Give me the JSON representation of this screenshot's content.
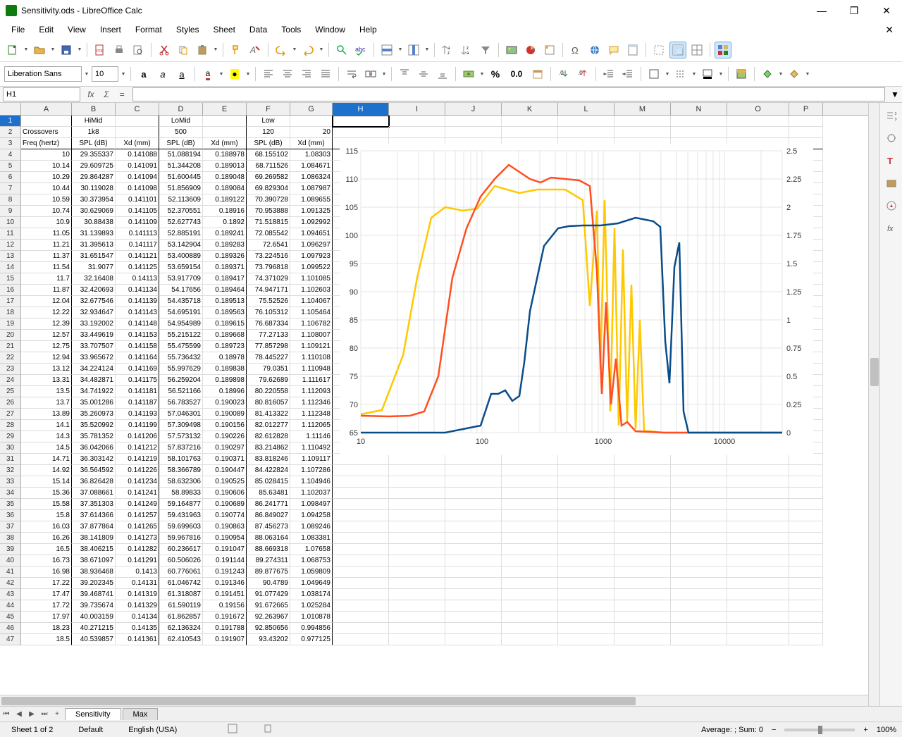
{
  "window": {
    "title": "Sensitivity.ods - LibreOffice Calc"
  },
  "menu": [
    "File",
    "Edit",
    "View",
    "Insert",
    "Format",
    "Styles",
    "Sheet",
    "Data",
    "Tools",
    "Window",
    "Help"
  ],
  "font": {
    "name": "Liberation Sans",
    "size": "10"
  },
  "namebox": "H1",
  "formula": "",
  "columns": [
    "A",
    "B",
    "C",
    "D",
    "E",
    "F",
    "G",
    "H",
    "I",
    "J",
    "K",
    "L",
    "M",
    "N",
    "O",
    "P"
  ],
  "col_widths": [
    "col-A",
    "col-B",
    "col-C",
    "col-D",
    "col-E",
    "col-F",
    "col-G",
    "col-H",
    "col-I",
    "col-J",
    "col-K",
    "col-L",
    "col-M",
    "col-N",
    "col-O",
    "col-P"
  ],
  "selected_col": "H",
  "header_row1": {
    "himid": "HiMid",
    "lomid": "LoMid",
    "low": "Low"
  },
  "header_row2": {
    "crossovers": "Crossovers",
    "v1": "1k8",
    "v2": "500",
    "v3": "120",
    "v4": "20"
  },
  "header_row3": {
    "freq": "Freq (hertz)",
    "spl": "SPL (dB)",
    "xd": "Xd (mm)"
  },
  "data_rows": [
    {
      "r": 4,
      "a": "10",
      "b": "29.355337",
      "c": "0.141088",
      "d": "51.088194",
      "e": "0.188978",
      "f": "68.155102",
      "g": "1.08303"
    },
    {
      "r": 5,
      "a": "10.14",
      "b": "29.609725",
      "c": "0.141091",
      "d": "51.344208",
      "e": "0.189013",
      "f": "68.711526",
      "g": "1.084671"
    },
    {
      "r": 6,
      "a": "10.29",
      "b": "29.864287",
      "c": "0.141094",
      "d": "51.600445",
      "e": "0.189048",
      "f": "69.269582",
      "g": "1.086324"
    },
    {
      "r": 7,
      "a": "10.44",
      "b": "30.119028",
      "c": "0.141098",
      "d": "51.856909",
      "e": "0.189084",
      "f": "69.829304",
      "g": "1.087987"
    },
    {
      "r": 8,
      "a": "10.59",
      "b": "30.373954",
      "c": "0.141101",
      "d": "52.113609",
      "e": "0.189122",
      "f": "70.390728",
      "g": "1.089655"
    },
    {
      "r": 9,
      "a": "10.74",
      "b": "30.629069",
      "c": "0.141105",
      "d": "52.370551",
      "e": "0.18916",
      "f": "70.953888",
      "g": "1.091325"
    },
    {
      "r": 10,
      "a": "10.9",
      "b": "30.88438",
      "c": "0.141109",
      "d": "52.627743",
      "e": "0.1892",
      "f": "71.518815",
      "g": "1.092992"
    },
    {
      "r": 11,
      "a": "11.05",
      "b": "31.139893",
      "c": "0.141113",
      "d": "52.885191",
      "e": "0.189241",
      "f": "72.085542",
      "g": "1.094651"
    },
    {
      "r": 12,
      "a": "11.21",
      "b": "31.395613",
      "c": "0.141117",
      "d": "53.142904",
      "e": "0.189283",
      "f": "72.6541",
      "g": "1.096297"
    },
    {
      "r": 13,
      "a": "11.37",
      "b": "31.651547",
      "c": "0.141121",
      "d": "53.400889",
      "e": "0.189326",
      "f": "73.224516",
      "g": "1.097923"
    },
    {
      "r": 14,
      "a": "11.54",
      "b": "31.9077",
      "c": "0.141125",
      "d": "53.659154",
      "e": "0.189371",
      "f": "73.796818",
      "g": "1.099522"
    },
    {
      "r": 15,
      "a": "11.7",
      "b": "32.16408",
      "c": "0.14113",
      "d": "53.917709",
      "e": "0.189417",
      "f": "74.371029",
      "g": "1.101085"
    },
    {
      "r": 16,
      "a": "11.87",
      "b": "32.420693",
      "c": "0.141134",
      "d": "54.17656",
      "e": "0.189464",
      "f": "74.947171",
      "g": "1.102603"
    },
    {
      "r": 17,
      "a": "12.04",
      "b": "32.677546",
      "c": "0.141139",
      "d": "54.435718",
      "e": "0.189513",
      "f": "75.52526",
      "g": "1.104067"
    },
    {
      "r": 18,
      "a": "12.22",
      "b": "32.934647",
      "c": "0.141143",
      "d": "54.695191",
      "e": "0.189563",
      "f": "76.105312",
      "g": "1.105464"
    },
    {
      "r": 19,
      "a": "12.39",
      "b": "33.192002",
      "c": "0.141148",
      "d": "54.954989",
      "e": "0.189615",
      "f": "76.687334",
      "g": "1.106782"
    },
    {
      "r": 20,
      "a": "12.57",
      "b": "33.449619",
      "c": "0.141153",
      "d": "55.215122",
      "e": "0.189668",
      "f": "77.27133",
      "g": "1.108007"
    },
    {
      "r": 21,
      "a": "12.75",
      "b": "33.707507",
      "c": "0.141158",
      "d": "55.475599",
      "e": "0.189723",
      "f": "77.857298",
      "g": "1.109121"
    },
    {
      "r": 22,
      "a": "12.94",
      "b": "33.965672",
      "c": "0.141164",
      "d": "55.736432",
      "e": "0.18978",
      "f": "78.445227",
      "g": "1.110108"
    },
    {
      "r": 23,
      "a": "13.12",
      "b": "34.224124",
      "c": "0.141169",
      "d": "55.997629",
      "e": "0.189838",
      "f": "79.0351",
      "g": "1.110948"
    },
    {
      "r": 24,
      "a": "13.31",
      "b": "34.482871",
      "c": "0.141175",
      "d": "56.259204",
      "e": "0.189898",
      "f": "79.62689",
      "g": "1.111617"
    },
    {
      "r": 25,
      "a": "13.5",
      "b": "34.741922",
      "c": "0.141181",
      "d": "56.521166",
      "e": "0.18996",
      "f": "80.220558",
      "g": "1.112093"
    },
    {
      "r": 26,
      "a": "13.7",
      "b": "35.001286",
      "c": "0.141187",
      "d": "56.783527",
      "e": "0.190023",
      "f": "80.816057",
      "g": "1.112346"
    },
    {
      "r": 27,
      "a": "13.89",
      "b": "35.260973",
      "c": "0.141193",
      "d": "57.046301",
      "e": "0.190089",
      "f": "81.413322",
      "g": "1.112348"
    },
    {
      "r": 28,
      "a": "14.1",
      "b": "35.520992",
      "c": "0.141199",
      "d": "57.309498",
      "e": "0.190156",
      "f": "82.012277",
      "g": "1.112065"
    },
    {
      "r": 29,
      "a": "14.3",
      "b": "35.781352",
      "c": "0.141206",
      "d": "57.573132",
      "e": "0.190226",
      "f": "82.612828",
      "g": "1.11146"
    },
    {
      "r": 30,
      "a": "14.5",
      "b": "36.042066",
      "c": "0.141212",
      "d": "57.837216",
      "e": "0.190297",
      "f": "83.214862",
      "g": "1.110492"
    },
    {
      "r": 31,
      "a": "14.71",
      "b": "36.303142",
      "c": "0.141219",
      "d": "58.101763",
      "e": "0.190371",
      "f": "83.818246",
      "g": "1.109117"
    },
    {
      "r": 32,
      "a": "14.92",
      "b": "36.564592",
      "c": "0.141226",
      "d": "58.366789",
      "e": "0.190447",
      "f": "84.422824",
      "g": "1.107286"
    },
    {
      "r": 33,
      "a": "15.14",
      "b": "36.826428",
      "c": "0.141234",
      "d": "58.632306",
      "e": "0.190525",
      "f": "85.028415",
      "g": "1.104946"
    },
    {
      "r": 34,
      "a": "15.36",
      "b": "37.088661",
      "c": "0.141241",
      "d": "58.89833",
      "e": "0.190606",
      "f": "85.63481",
      "g": "1.102037"
    },
    {
      "r": 35,
      "a": "15.58",
      "b": "37.351303",
      "c": "0.141249",
      "d": "59.164877",
      "e": "0.190689",
      "f": "86.241771",
      "g": "1.098497"
    },
    {
      "r": 36,
      "a": "15.8",
      "b": "37.614366",
      "c": "0.141257",
      "d": "59.431963",
      "e": "0.190774",
      "f": "86.849027",
      "g": "1.094258"
    },
    {
      "r": 37,
      "a": "16.03",
      "b": "37.877864",
      "c": "0.141265",
      "d": "59.699603",
      "e": "0.190863",
      "f": "87.456273",
      "g": "1.089246"
    },
    {
      "r": 38,
      "a": "16.26",
      "b": "38.141809",
      "c": "0.141273",
      "d": "59.967816",
      "e": "0.190954",
      "f": "88.063164",
      "g": "1.083381"
    },
    {
      "r": 39,
      "a": "16.5",
      "b": "38.406215",
      "c": "0.141282",
      "d": "60.236617",
      "e": "0.191047",
      "f": "88.669318",
      "g": "1.07658"
    },
    {
      "r": 40,
      "a": "16.73",
      "b": "38.671097",
      "c": "0.141291",
      "d": "60.506026",
      "e": "0.191144",
      "f": "89.274311",
      "g": "1.068753"
    },
    {
      "r": 41,
      "a": "16.98",
      "b": "38.936468",
      "c": "0.1413",
      "d": "60.776061",
      "e": "0.191243",
      "f": "89.877675",
      "g": "1.059809"
    },
    {
      "r": 42,
      "a": "17.22",
      "b": "39.202345",
      "c": "0.14131",
      "d": "61.046742",
      "e": "0.191346",
      "f": "90.4789",
      "g": "1.049649"
    },
    {
      "r": 43,
      "a": "17.47",
      "b": "39.468741",
      "c": "0.141319",
      "d": "61.318087",
      "e": "0.191451",
      "f": "91.077429",
      "g": "1.038174"
    },
    {
      "r": 44,
      "a": "17.72",
      "b": "39.735674",
      "c": "0.141329",
      "d": "61.590119",
      "e": "0.19156",
      "f": "91.672665",
      "g": "1.025284"
    },
    {
      "r": 45,
      "a": "17.97",
      "b": "40.003159",
      "c": "0.14134",
      "d": "61.862857",
      "e": "0.191672",
      "f": "92.263967",
      "g": "1.010878"
    },
    {
      "r": 46,
      "a": "18.23",
      "b": "40.271215",
      "c": "0.14135",
      "d": "62.136324",
      "e": "0.191788",
      "f": "92.850656",
      "g": "0.994856"
    },
    {
      "r": 47,
      "a": "18.5",
      "b": "40.539857",
      "c": "0.141361",
      "d": "62.410543",
      "e": "0.191907",
      "f": "93.43202",
      "g": "0.977125"
    }
  ],
  "tabs": {
    "active": "Sensitivity",
    "other": "Max"
  },
  "status": {
    "sheet": "Sheet 1 of 2",
    "style": "Default",
    "lang": "English (USA)",
    "avg": "Average: ; Sum: 0",
    "zoom": "100%"
  },
  "chart_data": {
    "type": "line",
    "x_scale": "log",
    "xlim": [
      10,
      30000
    ],
    "y_left": {
      "lim": [
        65,
        115
      ],
      "ticks": [
        65,
        70,
        75,
        80,
        85,
        90,
        95,
        100,
        105,
        110,
        115
      ]
    },
    "y_right": {
      "lim": [
        0,
        2.5
      ],
      "ticks": [
        0,
        0.25,
        0.5,
        0.75,
        1,
        1.25,
        1.5,
        1.75,
        2,
        2.25,
        2.5
      ]
    },
    "x_ticks": [
      10,
      100,
      1000,
      10000
    ],
    "series": [
      {
        "name": "Low SPL",
        "color": "#ffc800",
        "axis": "left"
      },
      {
        "name": "LoMid SPL",
        "color": "#ff4f1f",
        "axis": "left"
      },
      {
        "name": "HiMid SPL",
        "color": "#0a4c8a",
        "axis": "left"
      },
      {
        "name": "Xd",
        "color": "#ffc800",
        "axis": "right"
      }
    ]
  }
}
